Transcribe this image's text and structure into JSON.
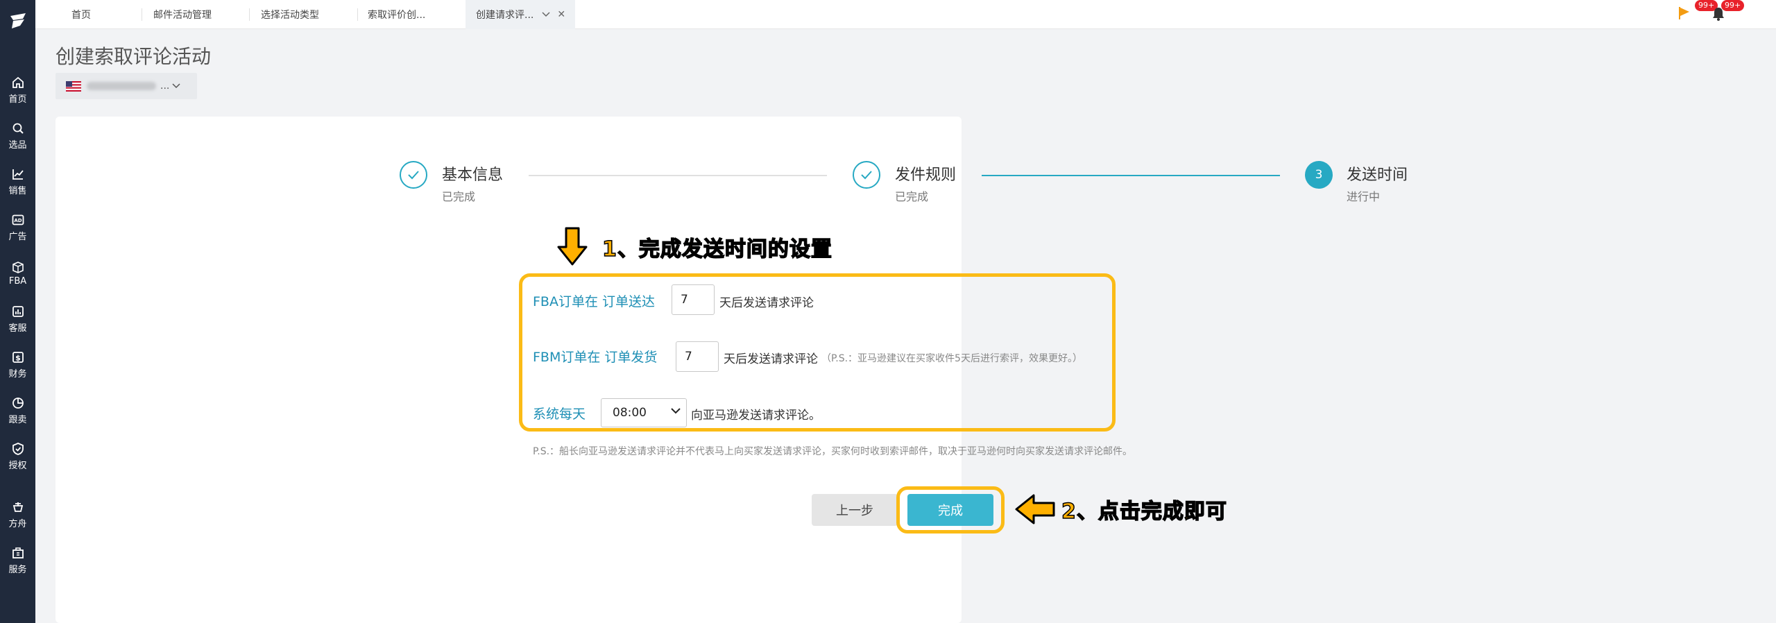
{
  "sidebar": {
    "items": [
      {
        "label": "首页",
        "icon": "home-icon"
      },
      {
        "label": "选品",
        "icon": "search-icon"
      },
      {
        "label": "销售",
        "icon": "chart-line-icon"
      },
      {
        "label": "广告",
        "icon": "ad-icon"
      },
      {
        "label": "FBA",
        "icon": "box-icon"
      },
      {
        "label": "客服",
        "icon": "report-icon"
      },
      {
        "label": "财务",
        "icon": "dollar-icon"
      },
      {
        "label": "跟卖",
        "icon": "pie-chart-icon"
      },
      {
        "label": "授权",
        "icon": "shield-icon"
      },
      {
        "label": "方舟",
        "icon": "ark-icon"
      },
      {
        "label": "服务",
        "icon": "building-icon"
      }
    ]
  },
  "tabs": [
    {
      "label": "首页"
    },
    {
      "label": "邮件活动管理"
    },
    {
      "label": "选择活动类型"
    },
    {
      "label": "索取评价创..."
    },
    {
      "label": "创建请求评..."
    }
  ],
  "top_badges": {
    "flag_count": "99+",
    "bell_count": "99+"
  },
  "page": {
    "title": "创建索取评论活动",
    "store_suffix": "..."
  },
  "steps": [
    {
      "title": "基本信息",
      "desc": "已完成",
      "state": "done"
    },
    {
      "title": "发件规则",
      "desc": "已完成",
      "state": "done"
    },
    {
      "number": "3",
      "title": "发送时间",
      "desc": "进行中",
      "state": "active"
    }
  ],
  "annotations": {
    "step1": "1、完成发送时间的设置",
    "step2": "2、点击完成即可"
  },
  "form": {
    "fba_label": "FBA订单在 订单送达",
    "fba_value": "7",
    "fba_suffix": "天后发送请求评论",
    "fbm_label": "FBM订单在 订单发货",
    "fbm_value": "7",
    "fbm_suffix": "天后发送请求评论",
    "fbm_hint": "（P.S.：亚马逊建议在买家收件5天后进行索评，效果更好。）",
    "daily_label": "系统每天",
    "daily_time": "08:00",
    "daily_suffix": "向亚马逊发送请求评论。",
    "note": "P.S.：船长向亚马逊发送请求评论并不代表马上向买家发送请求评论，买家何时收到索评邮件，取决于亚马逊何时向买家发送请求评论邮件。"
  },
  "buttons": {
    "prev": "上一步",
    "done": "完成"
  },
  "colors": {
    "accent": "#27a9c3",
    "highlight": "#fbbb16",
    "sidebar": "#202a3c"
  }
}
